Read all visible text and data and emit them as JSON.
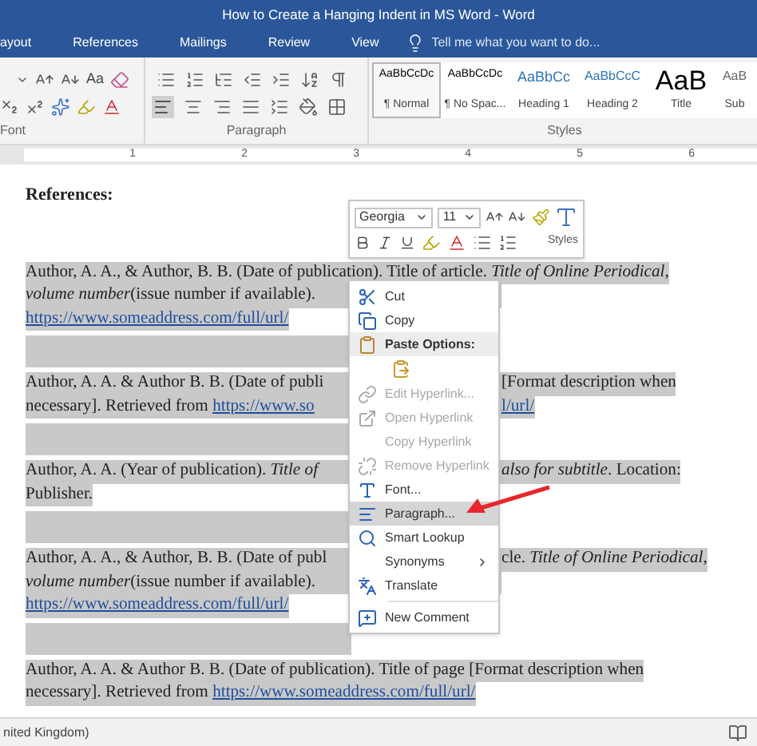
{
  "window": {
    "title": "How to Create a Hanging Indent in MS Word - Word"
  },
  "tabs": [
    {
      "label": "ayout",
      "selected": false
    },
    {
      "label": "References",
      "selected": false
    },
    {
      "label": "Mailings",
      "selected": false
    },
    {
      "label": "Review",
      "selected": false
    },
    {
      "label": "View",
      "selected": false
    }
  ],
  "tell_me": {
    "placeholder": "Tell me what you want to do..."
  },
  "ribbon": {
    "font_group": {
      "label": "Font",
      "case_button": "Aa"
    },
    "paragraph_group": {
      "label": "Paragraph"
    },
    "styles_group": {
      "label": "Styles",
      "styles": [
        {
          "preview": "AaBbCcDc",
          "name": "¶ Normal",
          "kind": "normal",
          "selected": true
        },
        {
          "preview": "AaBbCcDc",
          "name": "¶ No Spac...",
          "kind": "normal",
          "selected": false
        },
        {
          "preview": "AaBbCc",
          "name": "Heading 1",
          "kind": "heading",
          "selected": false
        },
        {
          "preview": "AaBbCcC",
          "name": "Heading 2",
          "kind": "heading2",
          "selected": false
        },
        {
          "preview": "AaB",
          "name": "Title",
          "kind": "title",
          "selected": false
        },
        {
          "preview": "AaB",
          "name": "Sub",
          "kind": "subtitle",
          "selected": false
        }
      ]
    }
  },
  "ruler": {
    "marks": [
      "1",
      "2",
      "3",
      "4",
      "5",
      "6"
    ]
  },
  "document": {
    "heading": "References:",
    "paragraphs": [
      {
        "kind": "entry",
        "selected": true,
        "lines": [
          {
            "segments": [
              {
                "kind": "text",
                "text": "Author, A. A., & Author, B. B. (Date of publication). Title of article. *Title of Online Periodical,*"
              }
            ]
          },
          {
            "left": [
              {
                "kind": "text",
                "text": "*volume number*(issue number if available)."
              }
            ]
          },
          {
            "segments": [
              {
                "kind": "link",
                "text": "https://www.someaddress.com/full/url/"
              }
            ]
          }
        ]
      },
      {
        "kind": "blank",
        "selected": true
      },
      {
        "kind": "entry",
        "selected": true,
        "lines": [
          {
            "left": [
              {
                "kind": "text",
                "text": "Author, A. A. & Author B. B. (Date of publi"
              }
            ],
            "right": [
              {
                "kind": "text",
                "text": "[Format description when"
              }
            ]
          },
          {
            "left": [
              {
                "kind": "text",
                "text": "necessary]. Retrieved from "
              },
              {
                "kind": "link",
                "text": "https://www.so"
              }
            ],
            "right": [
              {
                "kind": "link",
                "text": "l/url/"
              }
            ]
          }
        ]
      },
      {
        "kind": "blank",
        "selected": true
      },
      {
        "kind": "entry",
        "selected": true,
        "lines": [
          {
            "left": [
              {
                "kind": "text",
                "text": "Author, A. A. (Year of publication). *Title of*"
              }
            ],
            "right": [
              {
                "kind": "text",
                "text": "*also for subtitle*. Location:"
              }
            ]
          },
          {
            "segments": [
              {
                "kind": "text",
                "text": "Publisher."
              }
            ]
          }
        ]
      },
      {
        "kind": "blank",
        "selected": true
      },
      {
        "kind": "entry",
        "selected": true,
        "lines": [
          {
            "left": [
              {
                "kind": "text",
                "text": "Author, A. A., & Author, B. B. (Date of publ"
              }
            ],
            "right": [
              {
                "kind": "text",
                "text": "cle. *Title of Online Periodical,*"
              }
            ]
          },
          {
            "left": [
              {
                "kind": "text",
                "text": "*volume number*(issue number if available)."
              }
            ]
          },
          {
            "segments": [
              {
                "kind": "link",
                "text": "https://www.someaddress.com/full/url/"
              }
            ]
          }
        ]
      },
      {
        "kind": "blank",
        "selected": true
      },
      {
        "kind": "entry",
        "selected": true,
        "lines": [
          {
            "segments": [
              {
                "kind": "text",
                "text": "Author, A. A. & Author B. B. (Date of publication). Title of page [Format description when"
              }
            ]
          },
          {
            "segments": [
              {
                "kind": "text",
                "text": "necessary]. Retrieved from "
              },
              {
                "kind": "link",
                "text": "https://www.someaddress.com/full/url/"
              }
            ]
          }
        ]
      }
    ]
  },
  "mini_toolbar": {
    "font": "Georgia",
    "size": "11",
    "styles_label": "Styles"
  },
  "context_menu": {
    "items": [
      {
        "kind": "item",
        "label": "Cut",
        "disabled": false,
        "selected": false
      },
      {
        "kind": "item",
        "label": "Copy",
        "disabled": false,
        "selected": false
      },
      {
        "kind": "header",
        "label": "Paste Options:"
      },
      {
        "kind": "paste"
      },
      {
        "kind": "item",
        "label": "Edit Hyperlink...",
        "disabled": true,
        "selected": false
      },
      {
        "kind": "item",
        "label": "Open Hyperlink",
        "disabled": true,
        "selected": false
      },
      {
        "kind": "item",
        "label": "Copy Hyperlink",
        "disabled": true,
        "selected": false
      },
      {
        "kind": "item",
        "label": "Remove Hyperlink",
        "disabled": true,
        "selected": false
      },
      {
        "kind": "item",
        "label": "Font...",
        "disabled": false,
        "selected": false
      },
      {
        "kind": "item",
        "label": "Paragraph...",
        "disabled": false,
        "selected": true
      },
      {
        "kind": "item",
        "label": "Smart Lookup",
        "disabled": false,
        "selected": false
      },
      {
        "kind": "submenu",
        "label": "Synonyms",
        "disabled": false,
        "selected": false
      },
      {
        "kind": "item",
        "label": "Translate",
        "disabled": false,
        "selected": false
      },
      {
        "kind": "divider"
      },
      {
        "kind": "item",
        "label": "New Comment",
        "disabled": false,
        "selected": false
      }
    ]
  },
  "status_bar": {
    "language": "nited Kingdom)"
  }
}
